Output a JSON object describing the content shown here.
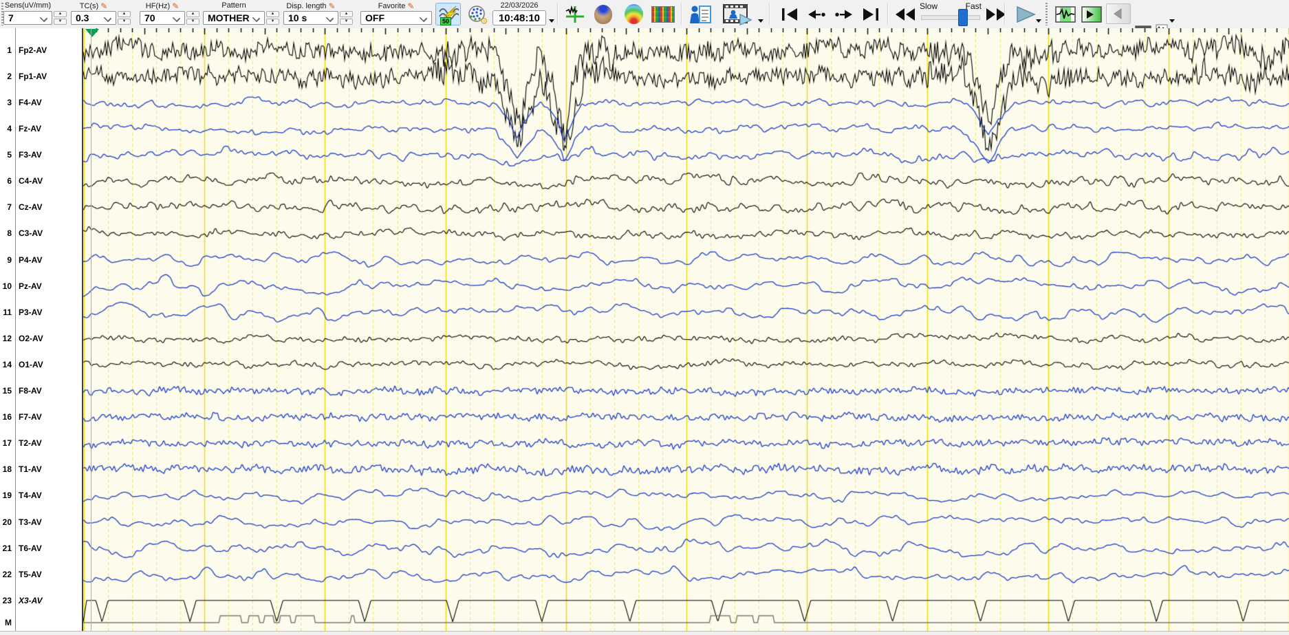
{
  "toolbar": {
    "sens": {
      "label": "Sens(uV/mm)",
      "value": "7"
    },
    "tc": {
      "label": "TC(s)",
      "value": "0.3"
    },
    "hf": {
      "label": "HF(Hz)",
      "value": "70"
    },
    "pattern": {
      "label": "Pattern",
      "value": "MOTHER"
    },
    "disp": {
      "label": "Disp. length",
      "value": "10 s"
    },
    "favorite": {
      "label": "Favorite",
      "value": "OFF"
    },
    "notch_badge": "50",
    "date": "22/03/2026",
    "time": "10:48:10",
    "speed": {
      "slow": "Slow",
      "fast": "Fast",
      "position_pct": 76
    }
  },
  "marker_label": "M",
  "plot": {
    "display_seconds": 10,
    "colors": {
      "bg": "#FDFCEC",
      "grid_major": "#F0DC00",
      "grid_minor": "#EFE45C",
      "trace_black": "#000000",
      "trace_blue": "#1C3BC8",
      "marker_gray": "#787878",
      "cursor_gray": "#ABABAB",
      "position_marker_green": "#00A550"
    }
  },
  "channels": [
    {
      "num": "1",
      "label": "Fp2-AV",
      "color": "black",
      "kind": "emg",
      "amp": 15,
      "seed": 101,
      "blink": 118
    },
    {
      "num": "2",
      "label": "Fp1-AV",
      "color": "black",
      "kind": "emg",
      "amp": 14,
      "seed": 102,
      "blink": 108
    },
    {
      "num": "3",
      "label": "F4-AV",
      "color": "blue",
      "kind": "alpha",
      "amp": 7,
      "seed": 103,
      "blink": 52
    },
    {
      "num": "4",
      "label": "Fz-AV",
      "color": "blue",
      "kind": "alpha",
      "amp": 7,
      "seed": 104,
      "blink": 46
    },
    {
      "num": "5",
      "label": "F3-AV",
      "color": "blue",
      "kind": "alpha",
      "amp": 9,
      "seed": 105,
      "blink": 14
    },
    {
      "num": "6",
      "label": "C4-AV",
      "color": "black",
      "kind": "mid",
      "amp": 9,
      "seed": 106,
      "blink": 0
    },
    {
      "num": "7",
      "label": "Cz-AV",
      "color": "black",
      "kind": "mid",
      "amp": 9,
      "seed": 107,
      "blink": 0
    },
    {
      "num": "8",
      "label": "C3-AV",
      "color": "black",
      "kind": "mid",
      "amp": 7,
      "seed": 108,
      "blink": 0
    },
    {
      "num": "9",
      "label": "P4-AV",
      "color": "blue",
      "kind": "slow",
      "amp": 10,
      "seed": 109,
      "blink": 0
    },
    {
      "num": "10",
      "label": "Pz-AV",
      "color": "blue",
      "kind": "slow",
      "amp": 11,
      "seed": 110,
      "blink": 0
    },
    {
      "num": "11",
      "label": "P3-AV",
      "color": "blue",
      "kind": "slow",
      "amp": 11,
      "seed": 111,
      "blink": 0
    },
    {
      "num": "12",
      "label": "O2-AV",
      "color": "black",
      "kind": "low",
      "amp": 6,
      "seed": 112,
      "blink": 0
    },
    {
      "num": "14",
      "label": "O1-AV",
      "color": "black",
      "kind": "low",
      "amp": 6,
      "seed": 114,
      "blink": 0
    },
    {
      "num": "15",
      "label": "F8-AV",
      "color": "blue",
      "kind": "dense",
      "amp": 6,
      "seed": 115,
      "blink": 0
    },
    {
      "num": "16",
      "label": "F7-AV",
      "color": "blue",
      "kind": "dense",
      "amp": 6,
      "seed": 116,
      "blink": 0
    },
    {
      "num": "17",
      "label": "T2-AV",
      "color": "blue",
      "kind": "dense",
      "amp": 6,
      "seed": 117,
      "blink": 0
    },
    {
      "num": "18",
      "label": "T1-AV",
      "color": "blue",
      "kind": "dense",
      "amp": 7,
      "seed": 118,
      "blink": 0
    },
    {
      "num": "19",
      "label": "T4-AV",
      "color": "blue",
      "kind": "slow",
      "amp": 9,
      "seed": 119,
      "blink": 0
    },
    {
      "num": "20",
      "label": "T3-AV",
      "color": "blue",
      "kind": "slow",
      "amp": 9,
      "seed": 120,
      "blink": 0
    },
    {
      "num": "21",
      "label": "T6-AV",
      "color": "blue",
      "kind": "slow",
      "amp": 11,
      "seed": 121,
      "blink": 0
    },
    {
      "num": "22",
      "label": "T5-AV",
      "color": "blue",
      "kind": "slow",
      "amp": 10,
      "seed": 122,
      "blink": 0
    },
    {
      "num": "23",
      "label": "X3-AV",
      "color": "black",
      "kind": "pulse",
      "amp": 31,
      "seed": 123,
      "blink": 0,
      "italic": true
    }
  ],
  "waveform": {
    "kinds": {
      "emg": [
        [
          2,
          1.0
        ],
        [
          9,
          0.55
        ],
        [
          40,
          0.5
        ]
      ],
      "mid": [
        [
          4,
          0.5
        ],
        [
          12,
          0.7
        ],
        [
          45,
          0.5
        ]
      ],
      "alpha": [
        [
          5,
          0.45
        ],
        [
          16,
          0.8
        ],
        [
          50,
          0.45
        ]
      ],
      "slow": [
        [
          6,
          0.35
        ],
        [
          20,
          0.9
        ],
        [
          60,
          0.6
        ]
      ],
      "dense": [
        [
          3,
          0.8
        ],
        [
          12,
          0.55
        ],
        [
          45,
          0.45
        ]
      ],
      "low": [
        [
          4,
          0.6
        ],
        [
          14,
          0.6
        ],
        [
          50,
          0.5
        ]
      ]
    },
    "blink_events": [
      {
        "t": 3.6,
        "w": 0.2
      },
      {
        "t": 3.99,
        "w": 0.19
      },
      {
        "t": 7.51,
        "w": 0.22
      }
    ],
    "emg_bursts": [
      [
        2.9,
        4.4,
        1.7
      ],
      [
        7.0,
        8.2,
        1.5
      ],
      [
        9.2,
        10.0,
        1.45
      ]
    ],
    "x3_spike_times": [
      0.15,
      0.88,
      1.6,
      2.33,
      3.06,
      3.8,
      4.53,
      5.26,
      5.98,
      6.71,
      7.44,
      8.17,
      8.9,
      9.62
    ],
    "m_pulses": [
      [
        1.12,
        1.31
      ],
      [
        1.36,
        1.46
      ],
      [
        1.49,
        1.58
      ],
      [
        1.62,
        1.72
      ],
      [
        1.75,
        1.92
      ],
      [
        2.21,
        2.25
      ],
      [
        5.19,
        5.37
      ],
      [
        5.41,
        5.56
      ],
      [
        5.59,
        5.73
      ]
    ]
  }
}
